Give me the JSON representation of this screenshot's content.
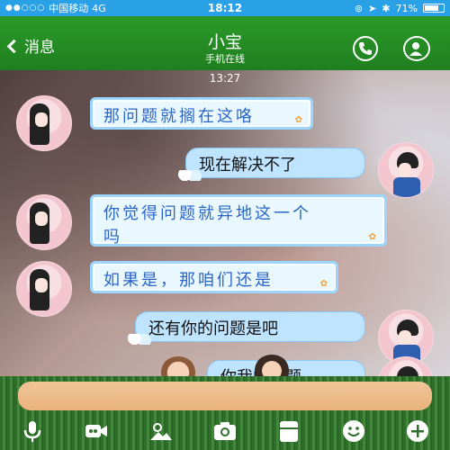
{
  "status_bar": {
    "signal_dots": "●●○○○",
    "carrier": "中国移动",
    "network": "4G",
    "time": "18:12",
    "battery_percent": "71%"
  },
  "nav": {
    "back_label": "消息",
    "title": "小宝",
    "subtitle": "手机在线"
  },
  "chat": {
    "timestamp": "13:27",
    "messages": [
      {
        "side": "in",
        "text": "那问题就搁在这咯"
      },
      {
        "side": "out",
        "text": "现在解决不了"
      },
      {
        "side": "in",
        "text": "你觉得问题就异地这一个",
        "text_line2": "吗"
      },
      {
        "side": "in",
        "text": "如果是，那咱们还是"
      },
      {
        "side": "out",
        "text": "还有你的问题是吧"
      },
      {
        "side": "out",
        "text": "你我的问题"
      }
    ]
  },
  "input": {
    "placeholder": ""
  },
  "toolbar": {
    "icons": [
      "microphone-icon",
      "video-icon",
      "image-icon",
      "camera-icon",
      "file-icon",
      "emoji-icon",
      "plus-icon"
    ]
  },
  "colors": {
    "status_bar": "#2aa1e6",
    "nav_bar": "#26901f",
    "bubble_in_border": "#9ad6ff",
    "bubble_out": "#bfe4ff"
  }
}
